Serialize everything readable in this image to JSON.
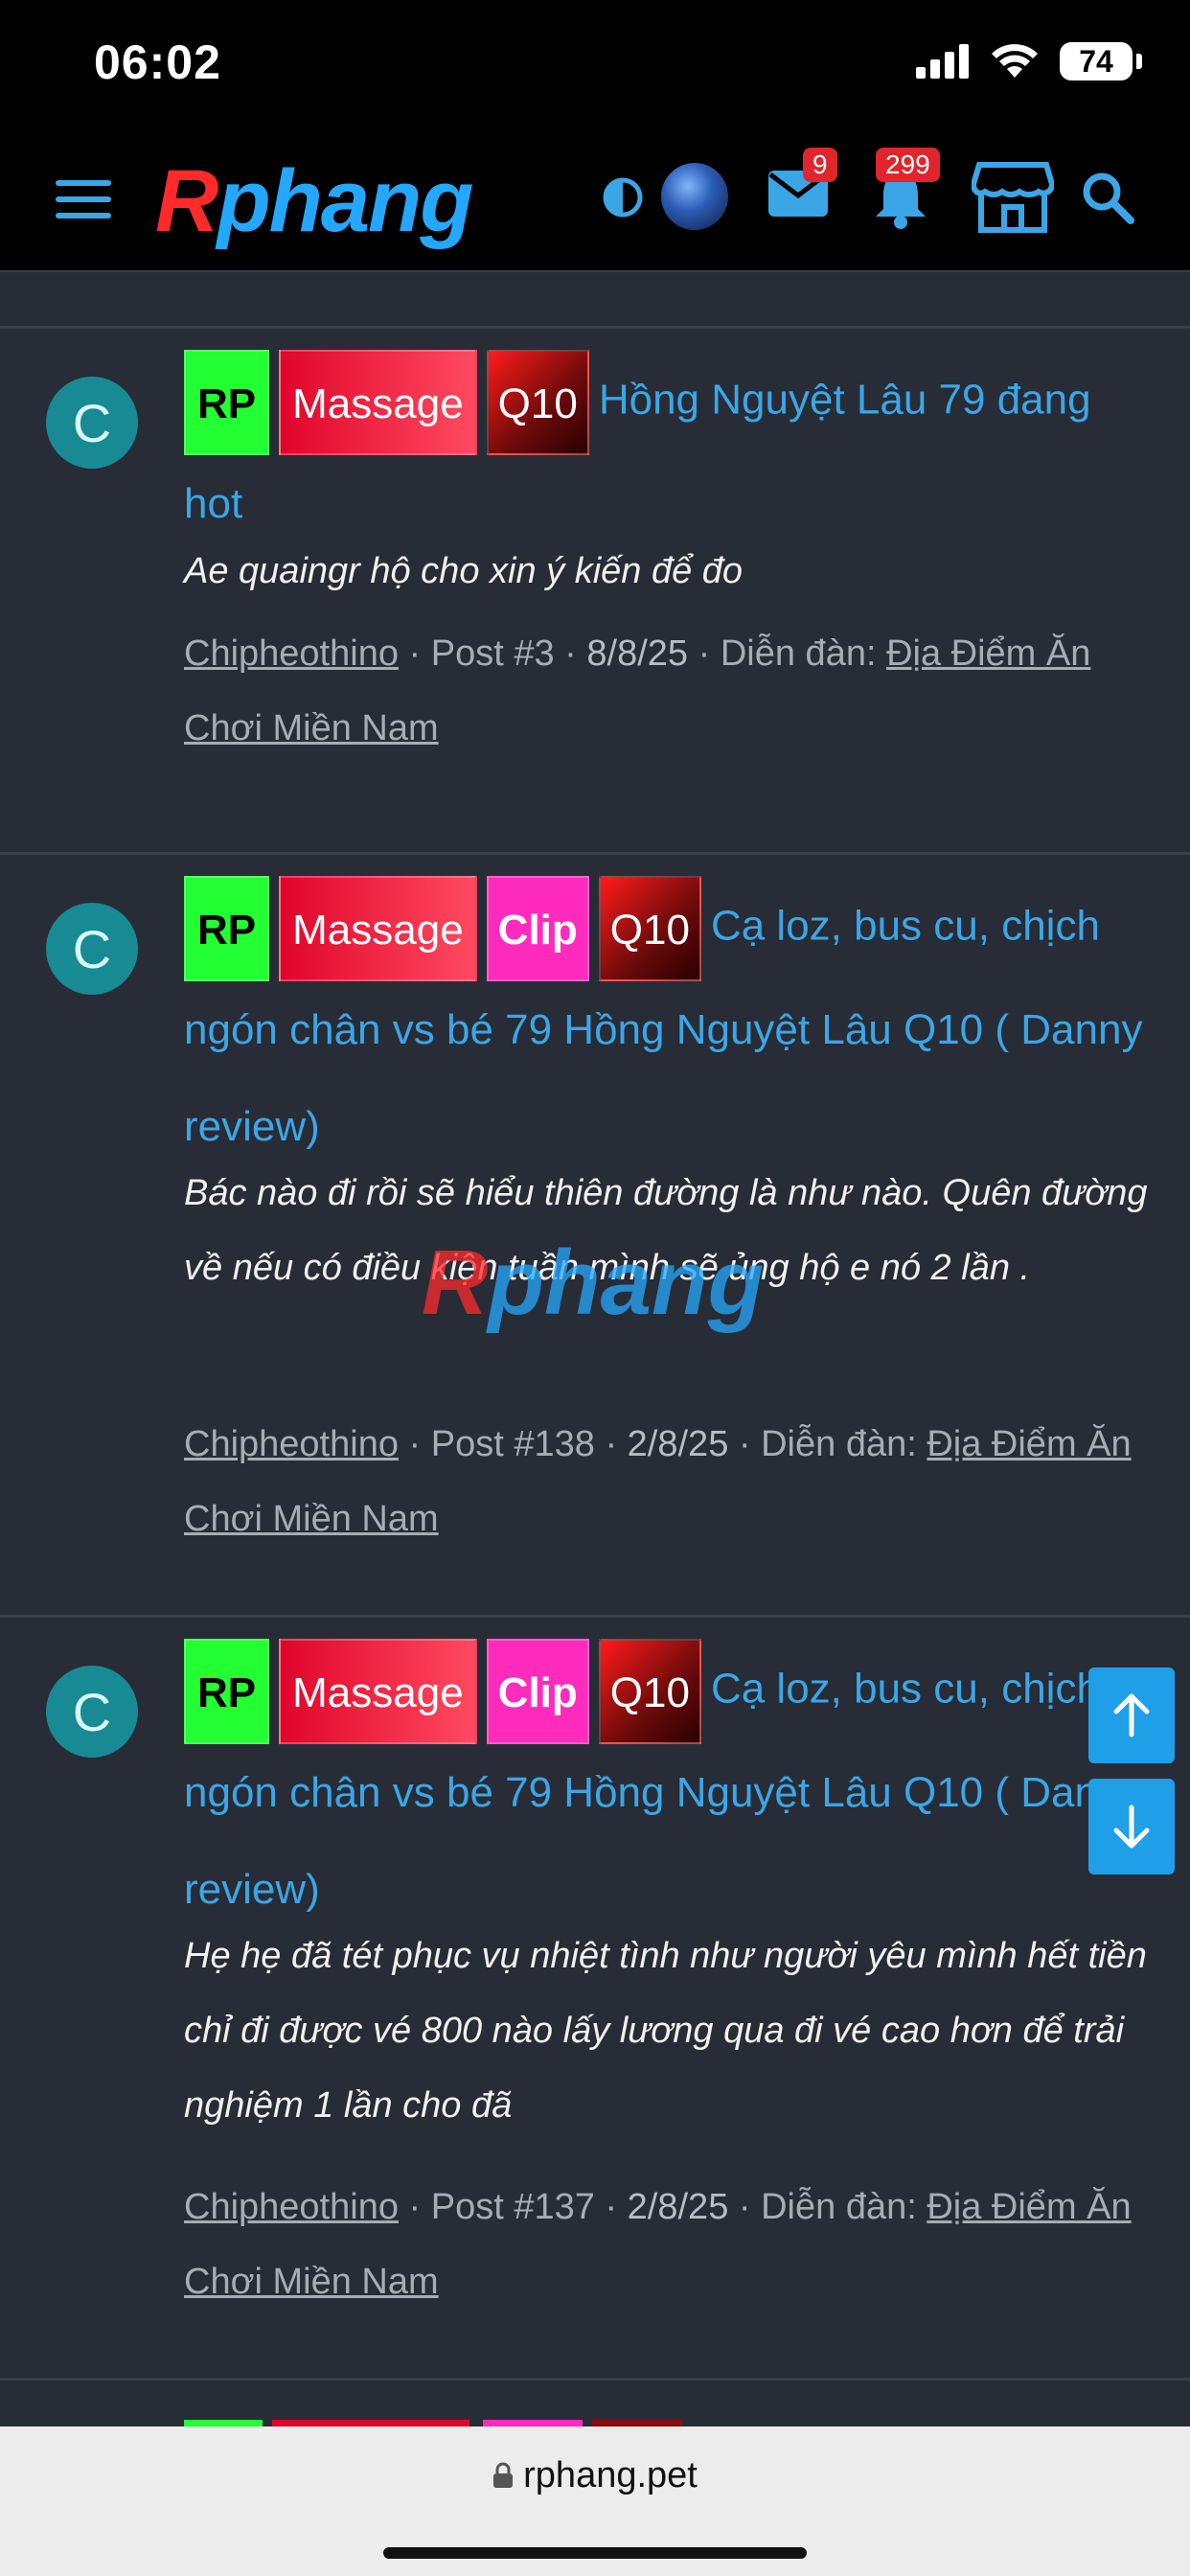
{
  "status": {
    "time": "06:02",
    "battery": "74"
  },
  "header": {
    "logo_r": "R",
    "logo_rest": "phang",
    "messages_badge": "9",
    "alerts_badge": "299"
  },
  "items": [
    {
      "avatar": "C",
      "tags": [
        "RP",
        "Massage",
        "Q10"
      ],
      "title": "Hồng Nguyệt Lâu 79 đang hot",
      "snippet": "Ae quaingr hộ cho xin ý kiến để đo",
      "author": "Chipheothino",
      "post": "Post #3",
      "date": "8/8/25",
      "forum_label": "Diễn đàn:",
      "forum": "Địa Điểm Ăn Chơi Miền Nam"
    },
    {
      "avatar": "C",
      "tags": [
        "RP",
        "Massage",
        "Clip",
        "Q10"
      ],
      "title": "Cạ loz, bus cu, chịch ngón chân vs bé 79 Hồng Nguyệt Lâu Q10 ( Danny review)",
      "snippet": "Bác nào đi rồi sẽ hiểu thiên đường là như nào. Quên đường về nếu có điều kiện tuần mình sẽ ủng hộ e nó 2 lần .",
      "author": "Chipheothino",
      "post": "Post #138",
      "date": "2/8/25",
      "forum_label": "Diễn đàn:",
      "forum": "Địa Điểm Ăn Chơi Miền Nam"
    },
    {
      "avatar": "C",
      "tags": [
        "RP",
        "Massage",
        "Clip",
        "Q10"
      ],
      "title": "Cạ loz, bus cu, chịch ngón chân vs bé 79 Hồng Nguyệt Lâu Q10 ( Danny review)",
      "snippet": "Hẹ hẹ đã tét phục vụ nhiệt tình như người yêu mình hết tiền chỉ đi được vé 800 nào lấy lương qua đi vé cao hơn để trải nghiệm 1 lần cho đã",
      "author": "Chipheothino",
      "post": "Post #137",
      "date": "2/8/25",
      "forum_label": "Diễn đàn:",
      "forum": "Địa Điểm Ăn Chơi Miền Nam"
    }
  ],
  "watermark": {
    "r": "R",
    "rest": "phang"
  },
  "browser": {
    "url": "rphang.pet"
  }
}
